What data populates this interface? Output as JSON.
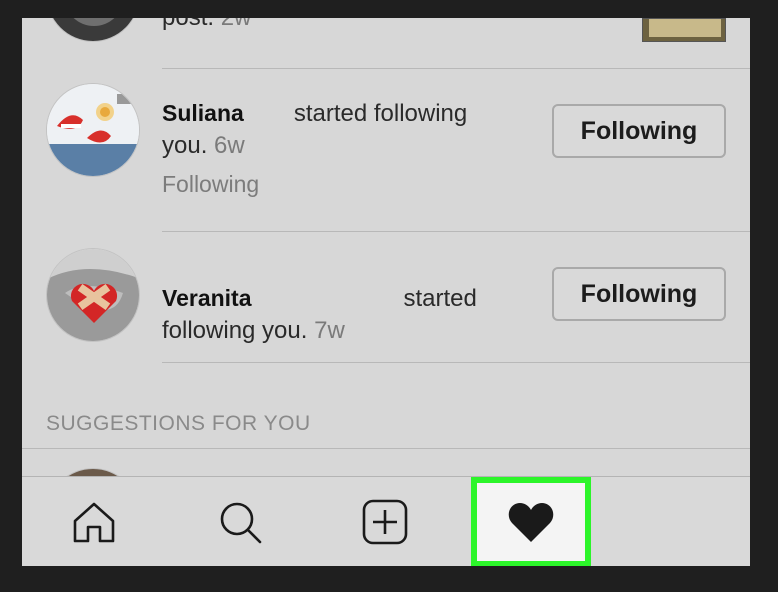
{
  "top_item": {
    "text_fragment": "post.",
    "time": "2w"
  },
  "notifications": [
    {
      "username": "Suliana",
      "action": "started following",
      "action_cont": "you.",
      "time": "6w",
      "status": "Following",
      "button_label": "Following"
    },
    {
      "username": "Veranita",
      "action": "started",
      "action_cont": "following you.",
      "time": "7w",
      "button_label": "Following"
    }
  ],
  "suggestions": {
    "title": "SUGGESTIONS FOR YOU"
  },
  "tabbar": {
    "items": [
      {
        "icon": "home-icon"
      },
      {
        "icon": "search-icon"
      },
      {
        "icon": "add-post-icon"
      },
      {
        "icon": "heart-icon",
        "active": true
      }
    ],
    "highlight_color": "#2cf52a"
  }
}
